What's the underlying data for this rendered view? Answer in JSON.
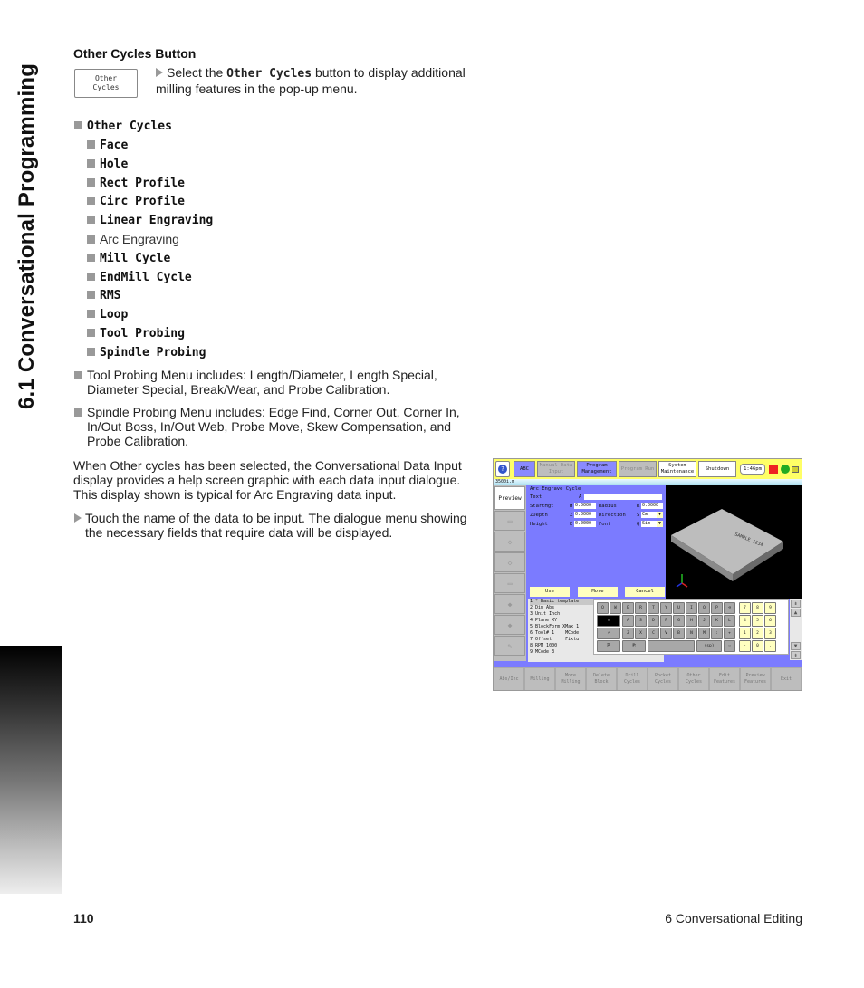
{
  "side_title": "6.1 Conversational Programming",
  "section": {
    "title": "Other Cycles Button",
    "button_image_label": [
      "Other",
      "Cycles"
    ],
    "instruction_pre": "Select the ",
    "instruction_code": "Other Cycles",
    "instruction_post": " button to display additional milling features in the pop-up menu."
  },
  "menu_list": {
    "root": "Other Cycles",
    "items": [
      {
        "label": "Face",
        "style": "code"
      },
      {
        "label": "Hole",
        "style": "code"
      },
      {
        "label": "Rect Profile",
        "style": "code"
      },
      {
        "label": "Circ Profile",
        "style": "code"
      },
      {
        "label": "Linear Engraving",
        "style": "code"
      },
      {
        "label": "Arc Engraving",
        "style": "plain"
      },
      {
        "label": "Mill Cycle",
        "style": "code"
      },
      {
        "label": "EndMill Cycle",
        "style": "code"
      },
      {
        "label": "RMS",
        "style": "code"
      },
      {
        "label": "Loop",
        "style": "code"
      },
      {
        "label": "Tool Probing",
        "style": "code"
      },
      {
        "label": "Spindle Probing",
        "style": "code"
      }
    ]
  },
  "notes": {
    "tool_probing": "Tool Probing Menu includes: Length/Diameter, Length Special, Diameter Special, Break/Wear, and Probe Calibration.",
    "spindle_probing": "Spindle Probing Menu includes: Edge Find, Corner Out, Corner In, In/Out Boss, In/Out Web, Probe Move, Skew Compensation, and Probe Calibration.",
    "description": "When Other cycles has been selected, the Conversational Data Input display provides a help screen graphic with each data input dialogue. This display shown is typical for Arc Engraving data input.",
    "instruction2": "Touch the name of the data to be input. The dialogue menu showing the necessary fields that require data will be displayed."
  },
  "screenshot": {
    "topbar": {
      "help": "?",
      "abc": "ABC",
      "manual_data_input": "Manual Data Input",
      "program_management": "Program Management",
      "program_run": "Program Run",
      "system_maintenance": "System Maintenance",
      "shutdown": "Shutdown",
      "time": "1:46pm"
    },
    "filename": "3500i.m",
    "side_tabs": {
      "preview": "Preview"
    },
    "form": {
      "title": "Arc Engrave Cycle",
      "text_label": "Text",
      "text_key": "A",
      "text_value": "",
      "starthgt_label": "StartHgt",
      "starthgt_key": "H",
      "starthgt_value": "0.0000",
      "zdepth_label": "ZDepth",
      "zdepth_key": "Z",
      "zdepth_value": "0.0000",
      "height_label": "Height",
      "height_key": "E",
      "height_value": "0.0000",
      "radius_label": "Radius",
      "radius_key": "R",
      "radius_value": "0.0000",
      "direction_label": "Direction",
      "direction_key": "S",
      "direction_value": "Cw",
      "font_label": "Font",
      "font_key": "Q",
      "font_value": "Sim",
      "use": "Use",
      "more": "More",
      "cancel": "Cancel"
    },
    "preview_text": "SAMPLE 1234",
    "code_lines": [
      "1 * Basic template",
      "2 Dim Abs",
      "3 Unit Inch",
      "4 Plane XY",
      "5 BlockForm XMax 1",
      "6 Tool# 1    MCode",
      "7 Offset     Fixtu",
      "8 RPM 1000",
      "9 MCode 3"
    ],
    "keyboard": {
      "row1": [
        "Q",
        "W",
        "E",
        "R",
        "T",
        "Y",
        "U",
        "I",
        "O",
        "P"
      ],
      "row2": [
        "A",
        "S",
        "D",
        "F",
        "G",
        "H",
        "J",
        "K",
        "L"
      ],
      "row3": [
        "Z",
        "X",
        "C",
        "V",
        "B",
        "N",
        "M",
        ":",
        "+"
      ],
      "space": "(sp)",
      "numpad": [
        "7",
        "8",
        "9",
        "4",
        "5",
        "6",
        "1",
        "2",
        "3",
        "-",
        "0",
        "."
      ]
    },
    "softkeys": [
      "Abs/Inc",
      "Milling",
      "More Milling",
      "Delete Block",
      "Drill Cycles",
      "Pocket Cycles",
      "Other Cycles",
      "Edit Features",
      "Preview Features",
      "Exit"
    ]
  },
  "footer": {
    "page_number": "110",
    "chapter": "6 Conversational Editing"
  }
}
